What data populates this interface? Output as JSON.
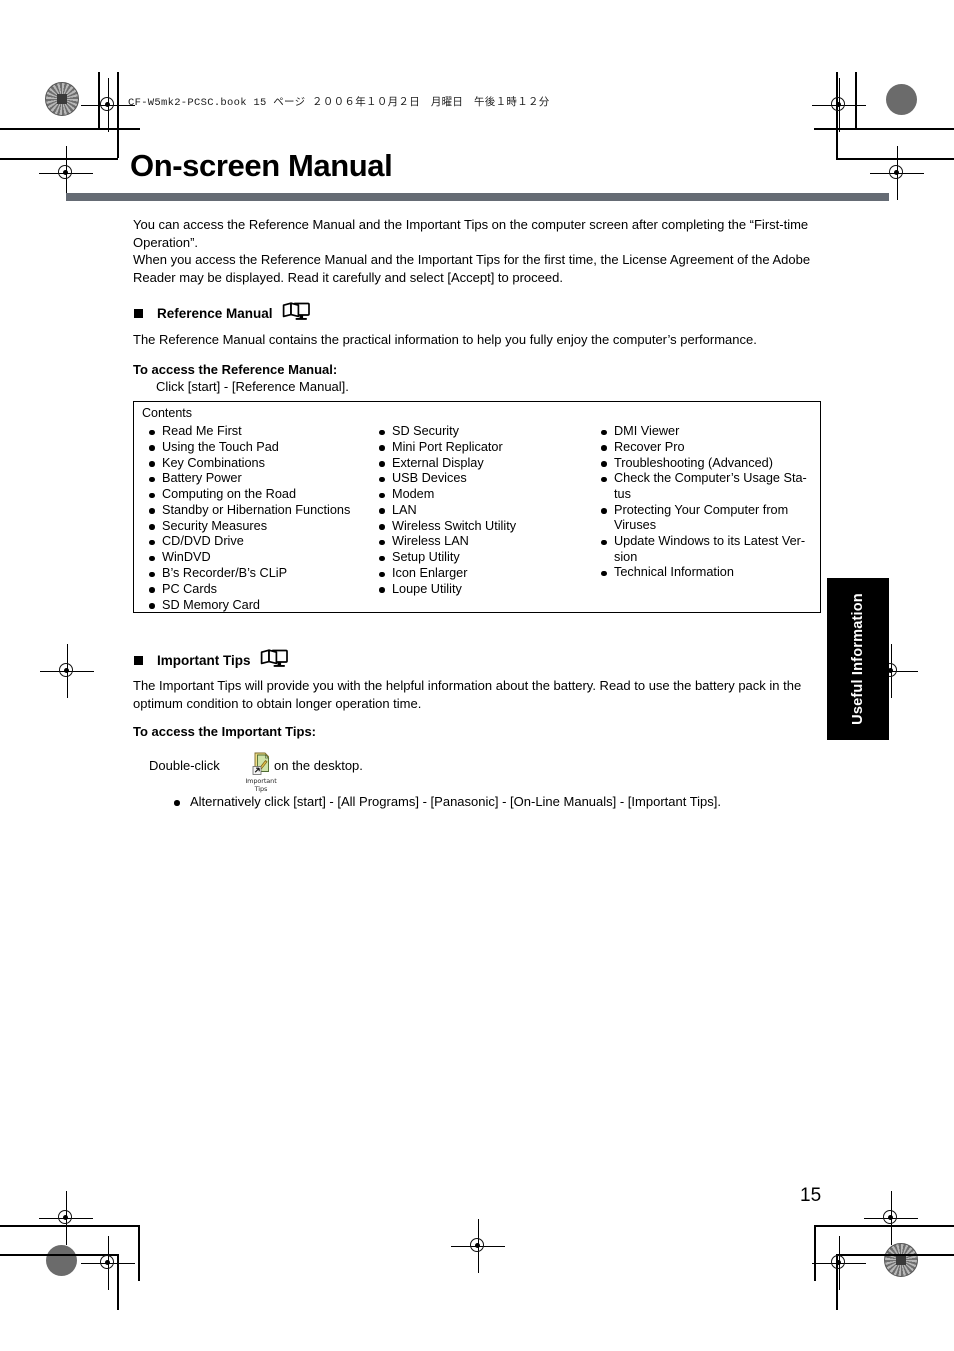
{
  "print_marks": {
    "slug_line": "CF-W5mk2-PCSC.book  15 ページ  ２００６年１０月２日　月曜日　午後１時１２分"
  },
  "page": {
    "title": "On-screen Manual",
    "number": "15",
    "side_tab_label": "Useful Information",
    "rule_color": "#656b74"
  },
  "intro": {
    "line1": "You can access the Reference Manual and the Important Tips on the computer screen after completing the “First-time",
    "line2": "Operation”.",
    "line3": "When you access the Reference Manual and the Important Tips for the first time, the License Agreement of the Adobe",
    "line4": "Reader may be displayed. Read it carefully and select [Accept] to proceed."
  },
  "reference_manual": {
    "heading": "Reference Manual",
    "heading_icon": "book-monitor-icon",
    "description": "The Reference Manual contains the practical information to help you fully enjoy the computer’s performance.",
    "access_heading": "To access the Reference Manual:",
    "access_step": "Click [start] - [Reference Manual].",
    "contents_label": "Contents",
    "contents_col1": [
      "Read Me First",
      "Using the Touch Pad",
      "Key Combinations",
      "Battery Power",
      "Computing on the Road",
      "Standby or Hibernation Functions",
      "Security Measures",
      "CD/DVD Drive",
      "WinDVD",
      "B’s Recorder/B’s CLiP",
      "PC Cards",
      "SD Memory Card"
    ],
    "contents_col2": [
      "SD Security",
      "Mini Port Replicator",
      "External Display",
      "USB Devices",
      "Modem",
      "LAN",
      "Wireless Switch Utility",
      "Wireless LAN",
      "Setup Utility",
      "Icon Enlarger",
      "Loupe Utility"
    ],
    "contents_col3": [
      "DMI Viewer",
      "Recover Pro",
      "Troubleshooting (Advanced)",
      "Check the Computer’s Usage Sta-\ntus",
      "Protecting Your Computer from\nViruses",
      "Update Windows to its Latest Ver-\nsion",
      "Technical Information"
    ]
  },
  "important_tips": {
    "heading": "Important Tips",
    "heading_icon": "book-monitor-icon",
    "description_line1": "The Important Tips will provide you with the helpful information about the battery. Read to use the battery pack in the",
    "description_line2": "optimum condition to obtain longer operation time.",
    "access_heading": "To access the Important Tips:",
    "double_click_prefix": "Double-click",
    "double_click_suffix": "on the desktop.",
    "desktop_icon_name": "important-tips-shortcut-icon",
    "desktop_icon_label": "Important Tips",
    "alternative": "Alternatively click [start] - [All Programs] - [Panasonic] - [On-Line Manuals] - [Important Tips]."
  }
}
